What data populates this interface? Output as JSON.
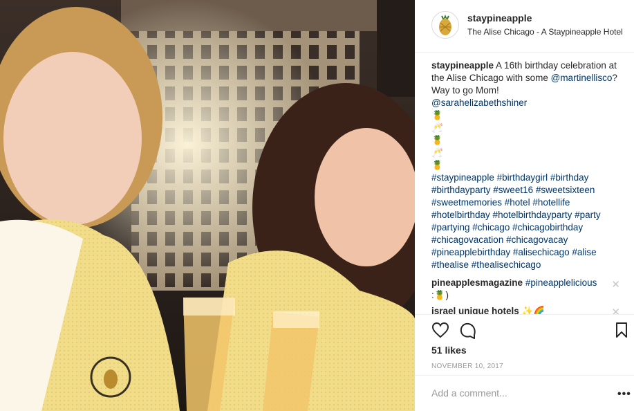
{
  "post": {
    "username": "staypineapple",
    "location": "The Alise Chicago - A Staypineapple Hotel"
  },
  "caption": {
    "username": "staypineapple",
    "text_1": "A 16th birthday celebration at the Alise Chicago with some",
    "mention_1": "@martinellisco",
    "text_2": "? Way to go Mom!",
    "mention_2": "@sarahelizabethshiner",
    "emoji_lines": [
      "🍍",
      "🥂",
      "🍍",
      "🥂",
      "🍍"
    ],
    "hashtags": "#staypineapple #birthdaygirl #birthday #birthdayparty #sweet16 #sweetsixteen #sweetmemories #hotel #hotellife #hotelbirthday #hotelbirthdayparty #party #partying #chicago #chicagobirthday #chicagovacation #chicagovacay #pineapplebirthday #alisechicago #alise #thealise #thealisechicago"
  },
  "comments": [
    {
      "username": "pineapplesmagazine",
      "link": "#pineapplelicious",
      "text": ":🍍)"
    },
    {
      "username": "israel unique hotels",
      "text": "✨🌈"
    }
  ],
  "actions": {
    "likes": "51 likes",
    "date": "NOVEMBER 10, 2017"
  },
  "add_comment": {
    "placeholder": "Add a comment...",
    "more": "•••"
  },
  "icons": {
    "like": "heart-icon",
    "comment": "comment-bubble-icon",
    "save": "bookmark-icon",
    "close": "close-icon"
  },
  "colors": {
    "link": "#003569",
    "border": "#efefef",
    "muted": "#999999"
  }
}
